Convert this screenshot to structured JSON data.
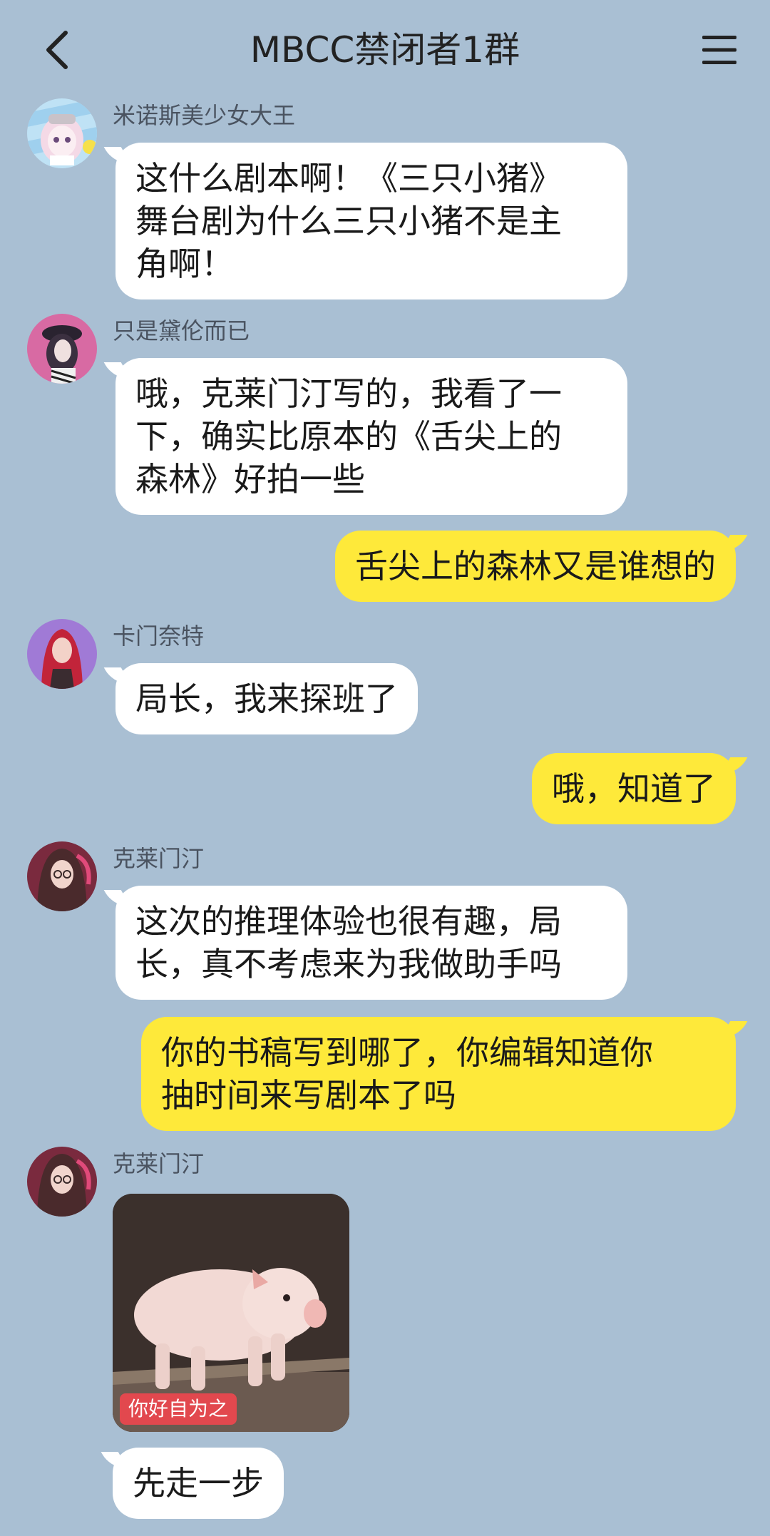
{
  "header": {
    "title": "MBCC禁闭者1群",
    "back_icon": "chevron-left-icon",
    "menu_icon": "menu-icon"
  },
  "colors": {
    "background": "#a9bfd3",
    "incoming_bubble": "#ffffff",
    "outgoing_bubble": "#fee93a",
    "caption_badge": "#e2484e"
  },
  "messages": [
    {
      "sender": "米诺斯美少女大王",
      "text": "这什么剧本啊！《三只小猪》\n舞台剧为什么三只小猪不是主\n角啊！",
      "direction": "in"
    },
    {
      "sender": "只是黛伦而已",
      "text": "哦，克莱门汀写的，我看了一\n下，确实比原本的《舌尖上的\n森林》好拍一些",
      "direction": "in"
    },
    {
      "text": "舌尖上的森林又是谁想的",
      "direction": "out"
    },
    {
      "sender": "卡门奈特",
      "text": "局长，我来探班了",
      "direction": "in"
    },
    {
      "text": "哦，知道了",
      "direction": "out"
    },
    {
      "sender": "克莱门汀",
      "text": "这次的推理体验也很有趣，局\n长，真不考虑来为我做助手吗",
      "direction": "in"
    },
    {
      "text": "你的书稿写到哪了，你编辑知道你\n抽时间来写剧本了吗",
      "direction": "out"
    },
    {
      "sender": "克莱门汀",
      "image_caption": "你好自为之",
      "image_subject": "piglet-sticker",
      "direction": "in"
    },
    {
      "text": "先走一步",
      "direction": "in"
    }
  ]
}
